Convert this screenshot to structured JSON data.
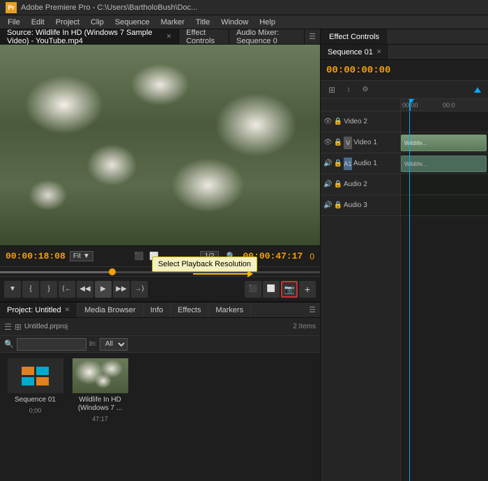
{
  "titlebar": {
    "title": "Adobe Premiere Pro - C:\\Users\\BartholoBush\\Doc...",
    "icon": "Pr"
  },
  "menubar": {
    "items": [
      "File",
      "Edit",
      "Project",
      "Clip",
      "Sequence",
      "Marker",
      "Title",
      "Window",
      "Help"
    ]
  },
  "source_monitor": {
    "tab_label": "Source: Wildlife In HD (Windows 7 Sample Video) - YouTube.mp4",
    "timecode_in": "00:00:18:08",
    "timecode_out": "00:00:47:17",
    "fit_label": "Fit",
    "resolution_label": "1/2"
  },
  "effect_controls": {
    "tab_label": "Effect Controls",
    "audio_mixer_label": "Audio Mixer: Sequence 0"
  },
  "tooltip": {
    "text": "Select Playback Resolution"
  },
  "controls": {
    "buttons": [
      "▼",
      "{",
      "}",
      "{←",
      "◀◀",
      "▶",
      "▶▶",
      "→}",
      "▣",
      "📷",
      "+"
    ]
  },
  "project_panel": {
    "tab_label": "Project: Untitled",
    "media_browser_label": "Media Browser",
    "info_label": "Info",
    "effects_label": "Effects",
    "markers_label": "Markers",
    "item_count": "2 Items",
    "search_placeholder": "🔍",
    "in_label": "In:",
    "in_options": [
      "All"
    ],
    "items": [
      {
        "name": "Untitled.prproj",
        "type": "project"
      },
      {
        "name": "Sequence 01",
        "duration": "0;00",
        "type": "sequence"
      },
      {
        "name": "Wildlife In HD (Windows 7 ...",
        "duration": "47:17",
        "type": "video"
      }
    ]
  },
  "sequence_panel": {
    "tab_label": "Sequence 01",
    "timecode": "00:00:00:00",
    "ruler_marks": [
      "00:00",
      "00:0"
    ],
    "tracks": [
      {
        "name": "Video 2",
        "type": "video",
        "index": 2
      },
      {
        "name": "Video 1",
        "type": "video",
        "index": 1,
        "target": "V"
      },
      {
        "name": "Audio 1",
        "type": "audio",
        "index": 1,
        "target": "A1"
      },
      {
        "name": "Audio 2",
        "type": "audio",
        "index": 2
      },
      {
        "name": "Audio 3",
        "type": "audio",
        "index": 3
      }
    ]
  },
  "colors": {
    "timecode": "#f5a000",
    "accent_blue": "#00aaff",
    "video_clip": "#5a8a5a",
    "seq_icon_teal": "#00aacc",
    "seq_icon_orange": "#e08020"
  }
}
